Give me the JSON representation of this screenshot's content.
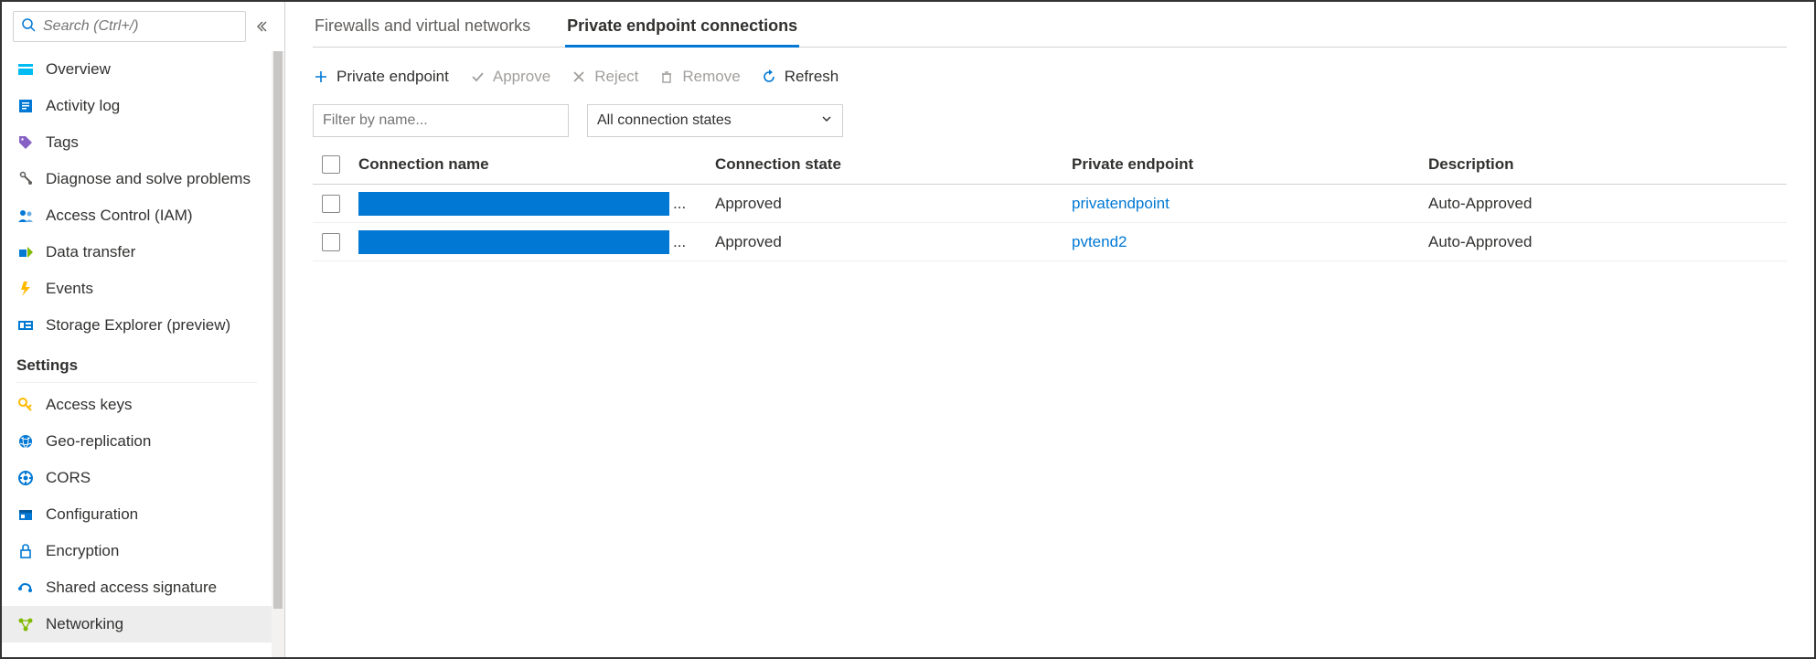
{
  "search": {
    "placeholder": "Search (Ctrl+/)"
  },
  "nav": {
    "top": [
      {
        "icon": "overview",
        "label": "Overview"
      },
      {
        "icon": "activity",
        "label": "Activity log"
      },
      {
        "icon": "tags",
        "label": "Tags"
      },
      {
        "icon": "diagnose",
        "label": "Diagnose and solve problems"
      },
      {
        "icon": "iam",
        "label": "Access Control (IAM)"
      },
      {
        "icon": "datatransfer",
        "label": "Data transfer"
      },
      {
        "icon": "events",
        "label": "Events"
      },
      {
        "icon": "explorer",
        "label": "Storage Explorer (preview)"
      }
    ],
    "section": "Settings",
    "settings": [
      {
        "icon": "accesskeys",
        "label": "Access keys"
      },
      {
        "icon": "geo",
        "label": "Geo-replication"
      },
      {
        "icon": "cors",
        "label": "CORS"
      },
      {
        "icon": "config",
        "label": "Configuration"
      },
      {
        "icon": "encryption",
        "label": "Encryption"
      },
      {
        "icon": "sas",
        "label": "Shared access signature"
      },
      {
        "icon": "networking",
        "label": "Networking",
        "selected": true
      }
    ]
  },
  "tabs": {
    "firewalls": "Firewalls and virtual networks",
    "private": "Private endpoint connections"
  },
  "toolbar": {
    "add": "Private endpoint",
    "approve": "Approve",
    "reject": "Reject",
    "remove": "Remove",
    "refresh": "Refresh"
  },
  "filters": {
    "name_placeholder": "Filter by name...",
    "state_label": "All connection states"
  },
  "table": {
    "headers": {
      "name": "Connection name",
      "state": "Connection state",
      "endpoint": "Private endpoint",
      "description": "Description"
    },
    "rows": [
      {
        "name_redacted": true,
        "state": "Approved",
        "endpoint": "privatendpoint",
        "description": "Auto-Approved"
      },
      {
        "name_redacted": true,
        "state": "Approved",
        "endpoint": "pvtend2",
        "description": "Auto-Approved"
      }
    ]
  }
}
